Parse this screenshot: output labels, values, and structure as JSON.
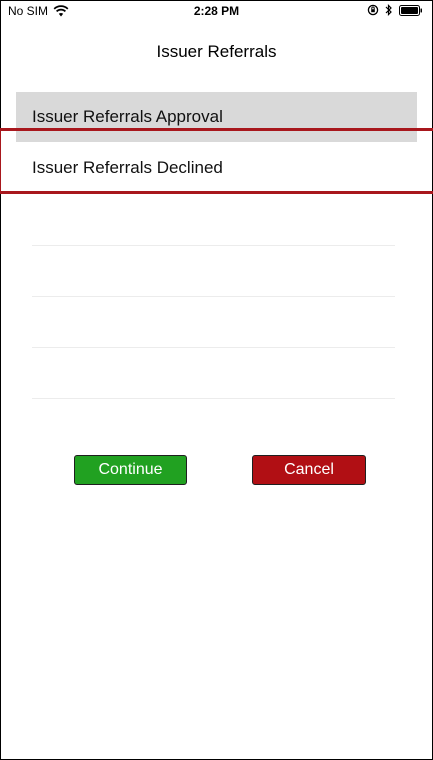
{
  "status_bar": {
    "carrier": "No SIM",
    "time": "2:28 PM",
    "icons": [
      "wifi-icon",
      "orientation-lock-icon",
      "bluetooth-icon",
      "battery-icon"
    ]
  },
  "header": {
    "title": "Issuer Referrals"
  },
  "list": {
    "items": [
      {
        "label": "Issuer Referrals Approval",
        "selected": true
      },
      {
        "label": "Issuer Referrals Declined",
        "selected": false
      }
    ]
  },
  "actions": {
    "continue_label": "Continue",
    "cancel_label": "Cancel",
    "continue_color": "#21a121",
    "cancel_color": "#b10f14"
  },
  "colors": {
    "selection_bg": "#d9d9d9",
    "highlight_border": "#a8171d"
  }
}
